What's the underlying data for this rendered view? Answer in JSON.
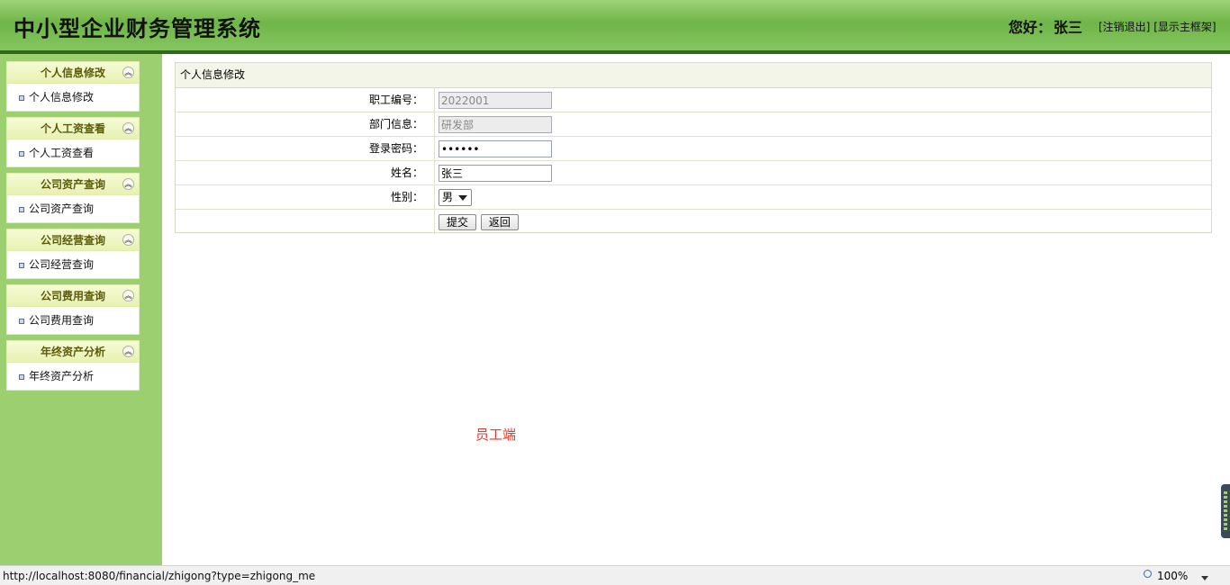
{
  "header": {
    "title": "中小型企业财务管理系统",
    "greeting": "您好：",
    "username": "张三",
    "logout_link": "[注销退出]",
    "frame_link": "[显示主框架]"
  },
  "sidebar": {
    "sections": [
      {
        "title": "个人信息修改",
        "item": "个人信息修改"
      },
      {
        "title": "个人工资查看",
        "item": "个人工资查看"
      },
      {
        "title": "公司资产查询",
        "item": "公司资产查询"
      },
      {
        "title": "公司经营查询",
        "item": "公司经营查询"
      },
      {
        "title": "公司费用查询",
        "item": "公司费用查询"
      },
      {
        "title": "年终资产分析",
        "item": "年终资产分析"
      }
    ]
  },
  "form": {
    "title": "个人信息修改",
    "employee_id_label": "职工编号：",
    "employee_id_value": "2022001",
    "department_label": "部门信息：",
    "department_value": "研发部",
    "password_label": "登录密码：",
    "password_value": "123456",
    "name_label": "姓名：",
    "name_value": "张三",
    "gender_label": "性别：",
    "gender_value": "男",
    "submit_label": "提交",
    "back_label": "返回"
  },
  "role_note": "员工端",
  "statusbar": {
    "url": "http://localhost:8080/financial/zhigong?type=zhigong_me",
    "zoom": "100%"
  },
  "colors": {
    "header_green": "#7cc052",
    "sidebar_green": "#9ccf6f",
    "section_text": "#5b5b08",
    "role_note": "#e2382d"
  }
}
